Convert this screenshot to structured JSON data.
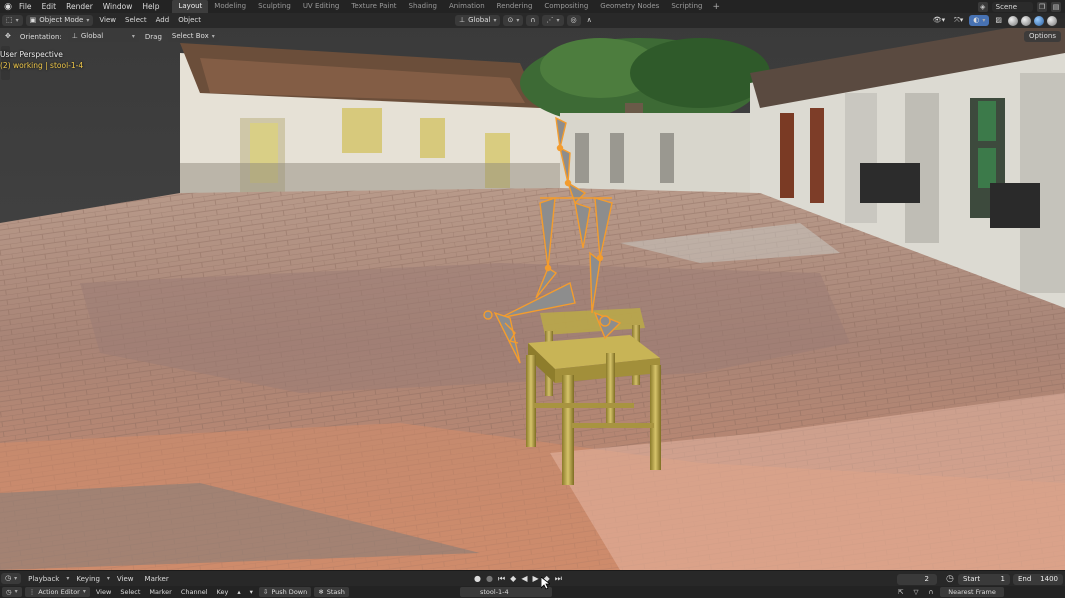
{
  "topbar": {
    "menu": [
      "File",
      "Edit",
      "Render",
      "Window",
      "Help"
    ],
    "workspaces": [
      "Layout",
      "Modeling",
      "Sculpting",
      "UV Editing",
      "Texture Paint",
      "Shading",
      "Animation",
      "Rendering",
      "Compositing",
      "Geometry Nodes",
      "Scripting"
    ],
    "active_workspace": "Layout",
    "add_tab": "+",
    "scene": "Scene"
  },
  "viewport_header": {
    "mode": "Object Mode",
    "menus": [
      "View",
      "Select",
      "Add",
      "Object"
    ],
    "transform_orientation": "Global"
  },
  "tool_header": {
    "orientation_label": "Orientation:",
    "orientation_value": "Global",
    "drag_label": "Drag",
    "drag_value": "Select Box",
    "options": "Options"
  },
  "viewport": {
    "perspective_label": "User Perspective",
    "object_label": "(2) working | stool-1-4"
  },
  "timeline": {
    "menus": [
      "Playback",
      "Keying",
      "View",
      "Marker"
    ],
    "current_frame": "2",
    "start_label": "Start",
    "start_value": "1",
    "end_label": "End",
    "end_value": "1400"
  },
  "action_editor": {
    "editor": "Action Editor",
    "menus": [
      "View",
      "Select",
      "Marker",
      "Channel",
      "Key"
    ],
    "push_down": "Push Down",
    "stash": "Stash",
    "action_name": "stool-1-4",
    "snapping": "Nearest Frame"
  },
  "colors": {
    "accent_active": "#4772b3",
    "selection_orange": "#f39c2e",
    "object_label": "#f0c84a"
  }
}
